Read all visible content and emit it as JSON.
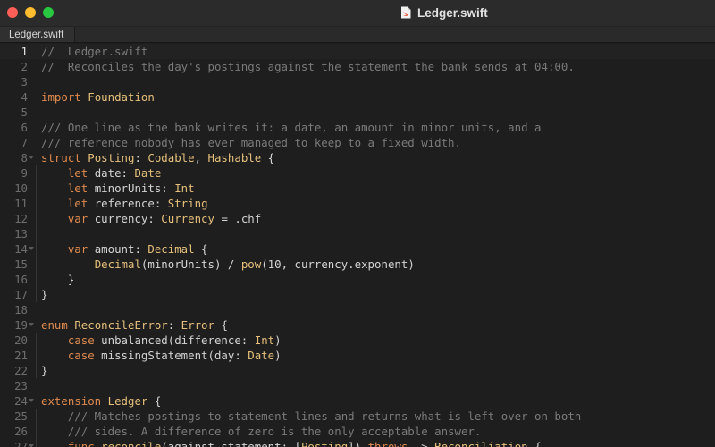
{
  "window": {
    "title": "Ledger.swift",
    "traffic_lights": {
      "close": "#ff5f57",
      "minimize": "#febc2e",
      "zoom": "#28c840"
    },
    "icon": "swift-file-icon"
  },
  "tabs": [
    {
      "label": "Ledger.swift",
      "active": true
    }
  ],
  "editor": {
    "current_line": 1,
    "colors": {
      "background": "#1e1e1e",
      "comment": "#7a7a7a",
      "keyword": "#e08a4e",
      "type": "#e6c07b",
      "text": "#d4d4d4",
      "line_number": "#6d6d6d",
      "current_line_number": "#e6e6e6"
    },
    "lines": [
      {
        "n": "1",
        "fold": false,
        "tokens": [
          [
            "c",
            "//  Ledger.swift"
          ]
        ]
      },
      {
        "n": "2",
        "fold": false,
        "tokens": [
          [
            "c",
            "//  Reconciles the day's postings against the statement the bank sends at 04:00."
          ]
        ]
      },
      {
        "n": "3",
        "fold": false,
        "tokens": []
      },
      {
        "n": "4",
        "fold": false,
        "tokens": [
          [
            "k",
            "import"
          ],
          [
            "p",
            " "
          ],
          [
            "t",
            "Foundation"
          ]
        ]
      },
      {
        "n": "5",
        "fold": false,
        "tokens": []
      },
      {
        "n": "6",
        "fold": false,
        "tokens": [
          [
            "c",
            "/// One line as the bank writes it: a date, an amount in minor units, and a"
          ]
        ]
      },
      {
        "n": "7",
        "fold": false,
        "tokens": [
          [
            "c",
            "/// reference nobody has ever managed to keep to a fixed width."
          ]
        ]
      },
      {
        "n": "8",
        "fold": true,
        "tokens": [
          [
            "k",
            "struct"
          ],
          [
            "p",
            " "
          ],
          [
            "t",
            "Posting"
          ],
          [
            "p",
            ": "
          ],
          [
            "t",
            "Codable"
          ],
          [
            "p",
            ", "
          ],
          [
            "t",
            "Hashable"
          ],
          [
            "p",
            " {"
          ]
        ]
      },
      {
        "n": "9",
        "fold": false,
        "tokens": [
          [
            "p",
            "    "
          ],
          [
            "k",
            "let"
          ],
          [
            "p",
            " date: "
          ],
          [
            "t",
            "Date"
          ]
        ]
      },
      {
        "n": "10",
        "fold": false,
        "tokens": [
          [
            "p",
            "    "
          ],
          [
            "k",
            "let"
          ],
          [
            "p",
            " minorUnits: "
          ],
          [
            "t",
            "Int"
          ]
        ]
      },
      {
        "n": "11",
        "fold": false,
        "tokens": [
          [
            "p",
            "    "
          ],
          [
            "k",
            "let"
          ],
          [
            "p",
            " reference: "
          ],
          [
            "t",
            "String"
          ]
        ]
      },
      {
        "n": "12",
        "fold": false,
        "tokens": [
          [
            "p",
            "    "
          ],
          [
            "k",
            "var"
          ],
          [
            "p",
            " currency: "
          ],
          [
            "t",
            "Currency"
          ],
          [
            "p",
            " = .chf"
          ]
        ]
      },
      {
        "n": "13",
        "fold": false,
        "tokens": []
      },
      {
        "n": "14",
        "fold": true,
        "tokens": [
          [
            "p",
            "    "
          ],
          [
            "k",
            "var"
          ],
          [
            "p",
            " amount: "
          ],
          [
            "t",
            "Decimal"
          ],
          [
            "p",
            " {"
          ]
        ]
      },
      {
        "n": "15",
        "fold": false,
        "tokens": [
          [
            "p",
            "        "
          ],
          [
            "t",
            "Decimal"
          ],
          [
            "p",
            "(minorUnits) / "
          ],
          [
            "t",
            "pow"
          ],
          [
            "p",
            "(10, currency.exponent)"
          ]
        ]
      },
      {
        "n": "16",
        "fold": false,
        "tokens": [
          [
            "p",
            "    }"
          ]
        ]
      },
      {
        "n": "17",
        "fold": false,
        "tokens": [
          [
            "p",
            "}"
          ]
        ]
      },
      {
        "n": "18",
        "fold": false,
        "tokens": []
      },
      {
        "n": "19",
        "fold": true,
        "tokens": [
          [
            "k",
            "enum"
          ],
          [
            "p",
            " "
          ],
          [
            "t",
            "ReconcileError"
          ],
          [
            "p",
            ": "
          ],
          [
            "t",
            "Error"
          ],
          [
            "p",
            " {"
          ]
        ]
      },
      {
        "n": "20",
        "fold": false,
        "tokens": [
          [
            "p",
            "    "
          ],
          [
            "k",
            "case"
          ],
          [
            "p",
            " unbalanced(difference: "
          ],
          [
            "t",
            "Int"
          ],
          [
            "p",
            ")"
          ]
        ]
      },
      {
        "n": "21",
        "fold": false,
        "tokens": [
          [
            "p",
            "    "
          ],
          [
            "k",
            "case"
          ],
          [
            "p",
            " missingStatement(day: "
          ],
          [
            "t",
            "Date"
          ],
          [
            "p",
            ")"
          ]
        ]
      },
      {
        "n": "22",
        "fold": false,
        "tokens": [
          [
            "p",
            "}"
          ]
        ]
      },
      {
        "n": "23",
        "fold": false,
        "tokens": []
      },
      {
        "n": "24",
        "fold": true,
        "tokens": [
          [
            "k",
            "extension"
          ],
          [
            "p",
            " "
          ],
          [
            "t",
            "Ledger"
          ],
          [
            "p",
            " {"
          ]
        ]
      },
      {
        "n": "25",
        "fold": false,
        "tokens": [
          [
            "p",
            "    "
          ],
          [
            "c",
            "/// Matches postings to statement lines and returns what is left over on both"
          ]
        ]
      },
      {
        "n": "26",
        "fold": false,
        "tokens": [
          [
            "p",
            "    "
          ],
          [
            "c",
            "/// sides. A difference of zero is the only acceptable answer."
          ]
        ]
      },
      {
        "n": "27",
        "fold": true,
        "tokens": [
          [
            "p",
            "    "
          ],
          [
            "k",
            "func"
          ],
          [
            "p",
            " "
          ],
          [
            "t",
            "reconcile"
          ],
          [
            "p",
            "(against statement: ["
          ],
          [
            "t",
            "Posting"
          ],
          [
            "p",
            "]) "
          ],
          [
            "k",
            "throws"
          ],
          [
            "p",
            " -> "
          ],
          [
            "t",
            "Reconciliation"
          ],
          [
            "p",
            " {"
          ]
        ]
      }
    ]
  }
}
